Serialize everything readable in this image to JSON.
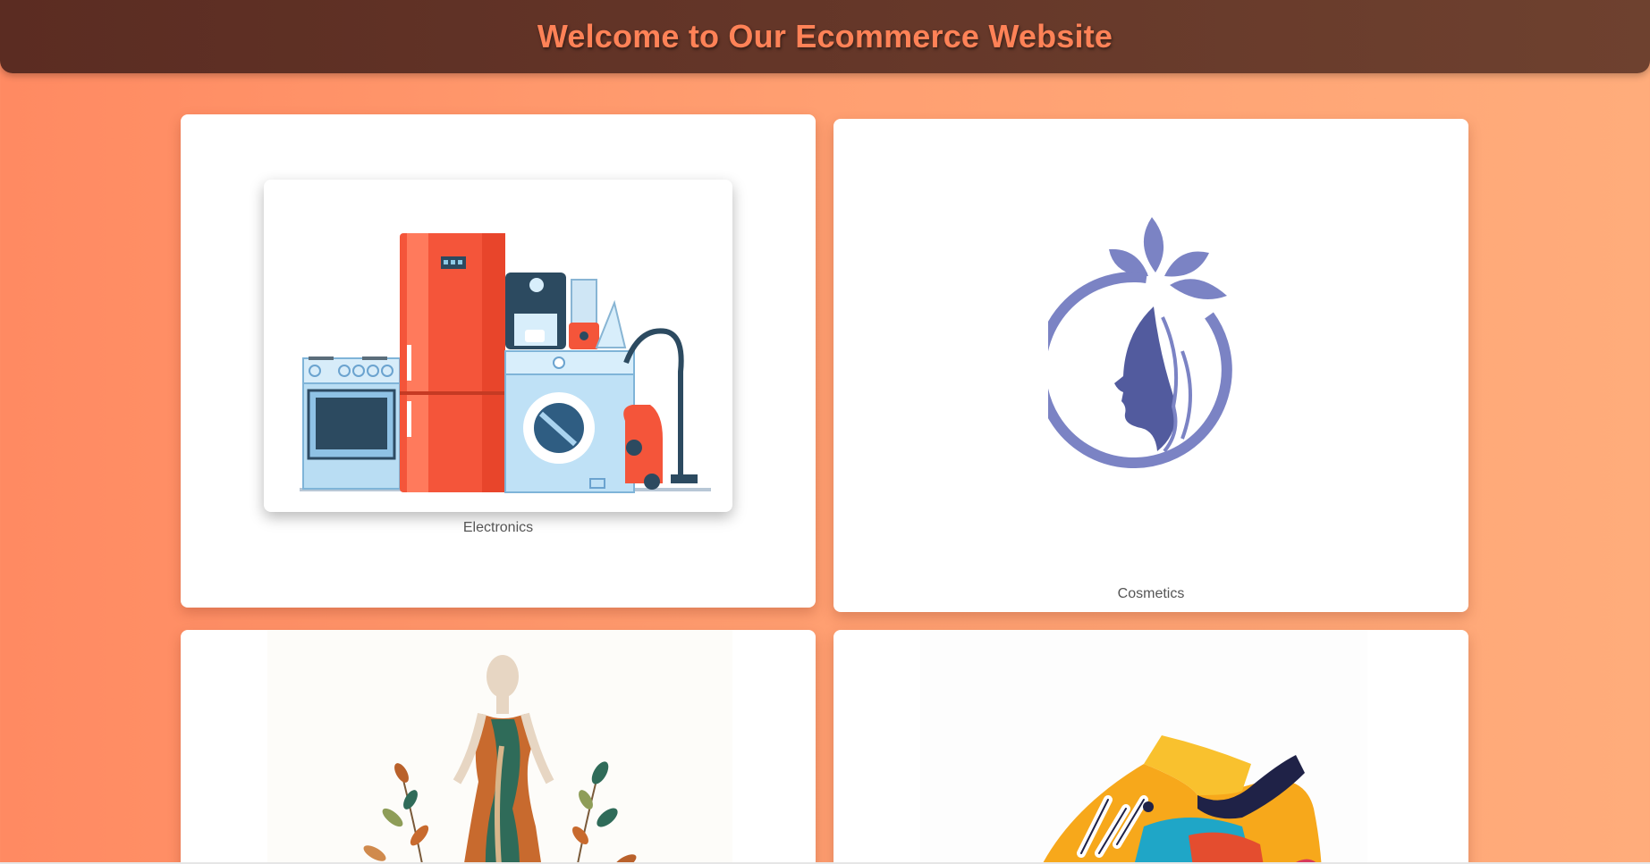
{
  "header": {
    "title": "Welcome to Our Ecommerce Website"
  },
  "categories": [
    {
      "label": "Electronics",
      "image_icon": "home-appliances-illustration"
    },
    {
      "label": "Cosmetics",
      "image_icon": "woman-face-logo"
    },
    {
      "label": "",
      "image_icon": "fashion-dress-illustration"
    },
    {
      "label": "",
      "image_icon": "sneaker-illustration"
    }
  ],
  "colors": {
    "header_bg": "#5b2c22",
    "title_color": "#ff8257",
    "page_bg": "#ff9f71",
    "cosmetics_logo": "#7b83c4"
  }
}
